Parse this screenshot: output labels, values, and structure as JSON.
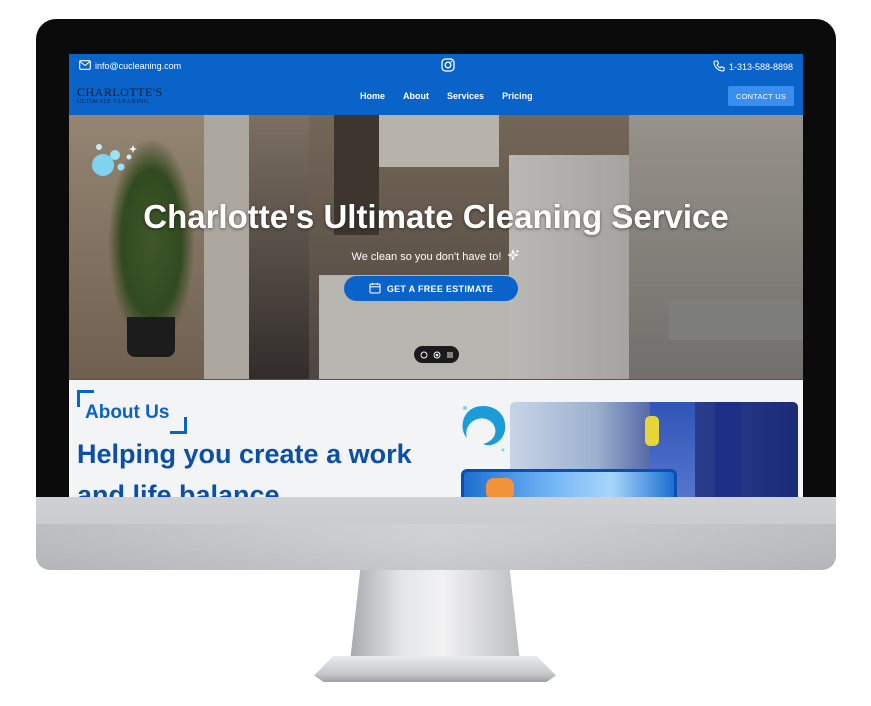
{
  "topbar": {
    "email": "info@cucleaning.com",
    "phone": "1-313-588-8898",
    "instagram_icon": "instagram-icon",
    "email_icon": "mail-icon",
    "phone_icon": "phone-icon"
  },
  "navbar": {
    "logo_line1": "CHARLOTTE'S",
    "logo_line2": "ULTIMATE CLEANING",
    "items": [
      {
        "label": "Home"
      },
      {
        "label": "About"
      },
      {
        "label": "Services"
      },
      {
        "label": "Pricing"
      }
    ],
    "contact_label": "CONTACT US"
  },
  "hero": {
    "title": "Charlotte's Ultimate Cleaning Service",
    "subtitle": "We clean so you don't have to!",
    "button_label": "GET A FREE ESTIMATE",
    "button_icon": "calendar-icon",
    "sparkle_icon": "sparkles-icon"
  },
  "about": {
    "label": "About Us",
    "headline": "Helping you create a work and life balance"
  },
  "colors": {
    "brand_blue": "#0a63c9",
    "headline_blue": "#0b4fa6",
    "contact_button": "#3a8ef0"
  }
}
